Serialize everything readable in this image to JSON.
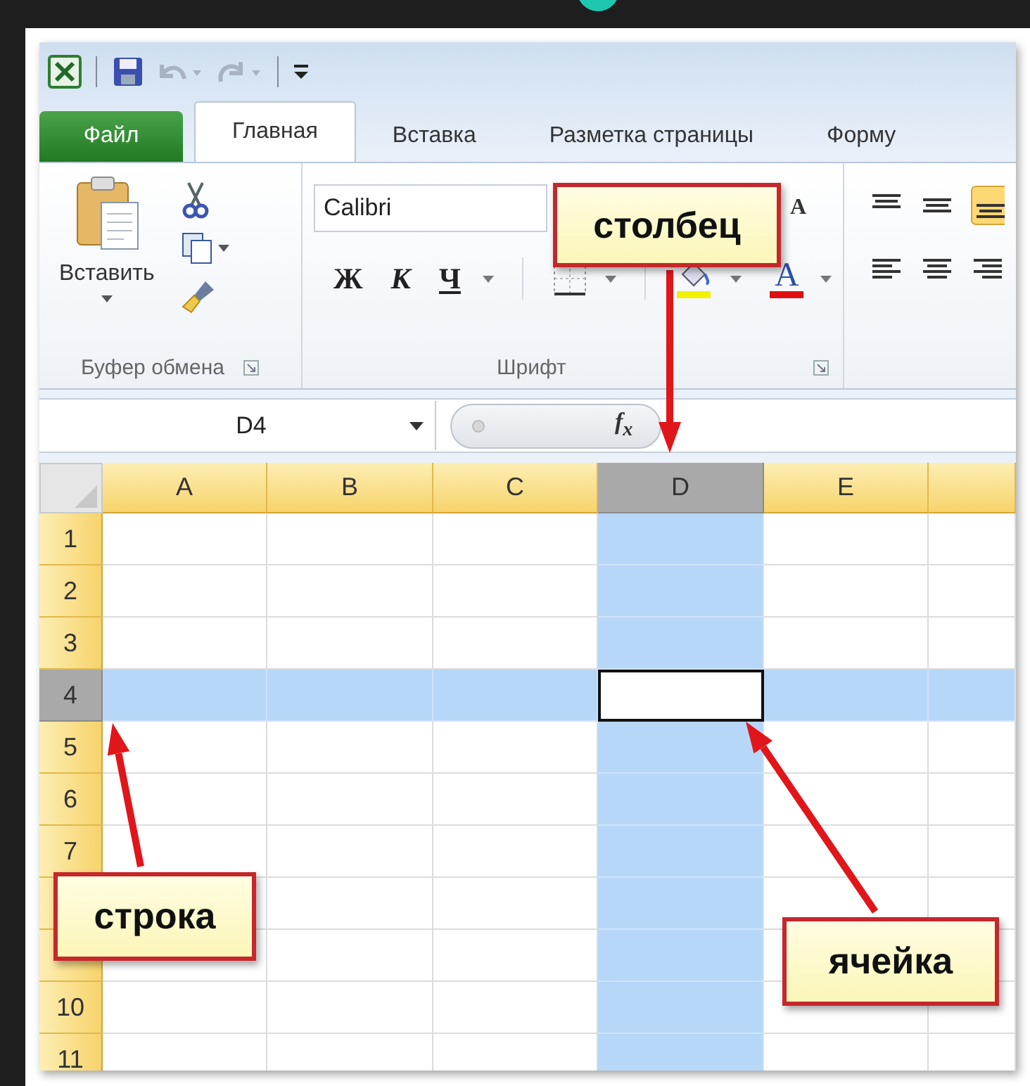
{
  "tabs": [
    {
      "label": "Файл",
      "kind": "file",
      "selected": false
    },
    {
      "label": "Главная",
      "kind": "tab",
      "selected": true
    },
    {
      "label": "Вставка",
      "kind": "tab",
      "selected": false
    },
    {
      "label": "Разметка страницы",
      "kind": "tab",
      "selected": false
    },
    {
      "label": "Форму",
      "kind": "tab",
      "selected": false
    }
  ],
  "ribbon": {
    "clipboard": {
      "paste_label": "Вставить",
      "group_label": "Буфер обмена"
    },
    "font": {
      "font_name": "Calibri",
      "grow_font": "A",
      "bold": "Ж",
      "italic": "К",
      "underline": "Ч",
      "font_color": "A",
      "group_label": "Шрифт"
    }
  },
  "formula_bar": {
    "name_box": "D4",
    "function_label": "f$_{x}$"
  },
  "sheet": {
    "columns": [
      {
        "label": "A",
        "selected": false
      },
      {
        "label": "B",
        "selected": false
      },
      {
        "label": "C",
        "selected": false
      },
      {
        "label": "D",
        "selected": true
      },
      {
        "label": "E",
        "selected": false
      },
      {
        "selected": false
      }
    ],
    "rows": [
      {
        "label": "1",
        "selected": false
      },
      {
        "label": "2",
        "selected": false
      },
      {
        "label": "3",
        "selected": false
      },
      {
        "label": "4",
        "selected": true
      },
      {
        "label": "5",
        "selected": false
      },
      {
        "label": "6",
        "selected": false
      },
      {
        "label": "7",
        "selected": false
      },
      {
        "selected": false
      },
      {
        "selected": false
      },
      {
        "label": "10",
        "selected": false
      },
      {
        "label": "11",
        "selected": false
      }
    ]
  },
  "callouts": [
    {
      "text": "столбец"
    },
    {
      "text": "строка"
    },
    {
      "text": "ячейка"
    }
  ]
}
